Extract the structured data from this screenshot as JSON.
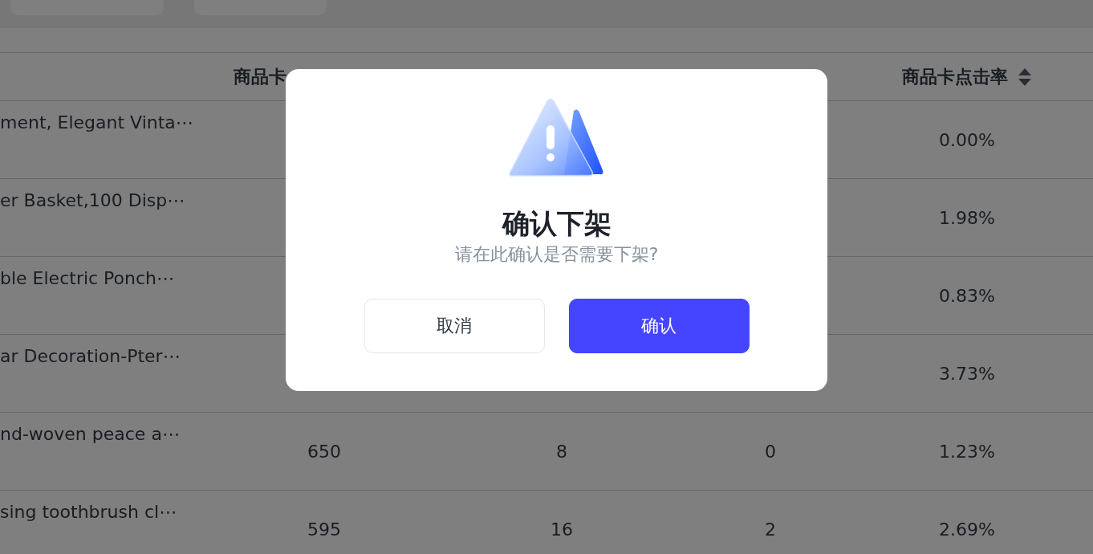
{
  "table": {
    "columns": [
      {},
      {
        "label": "商品卡"
      },
      {},
      {},
      {
        "label": "商品卡点击率",
        "sortable": true
      }
    ],
    "rows": [
      {
        "cells": [
          "ment, Elegant Vinta⋯",
          null,
          null,
          null,
          "0.00%"
        ]
      },
      {
        "cells": [
          "er Basket,100 Disp⋯",
          null,
          null,
          null,
          "1.98%"
        ]
      },
      {
        "cells": [
          "ble Electric Ponch⋯",
          null,
          null,
          null,
          "0.83%"
        ]
      },
      {
        "cells": [
          "ar Decoration-Pter⋯",
          null,
          null,
          null,
          "3.73%"
        ]
      },
      {
        "cells": [
          "nd-woven peace a⋯",
          "650",
          "8",
          "0",
          "1.23%"
        ]
      },
      {
        "cells": [
          "sing toothbrush cl⋯",
          "595",
          "16",
          "2",
          "2.69%"
        ]
      }
    ]
  },
  "dialog": {
    "title": "确认下架",
    "message": "请在此确认是否需要下架?",
    "buttons": [
      {
        "label": "取消",
        "kind": "secondary"
      },
      {
        "label": "确认",
        "kind": "primary"
      }
    ]
  }
}
